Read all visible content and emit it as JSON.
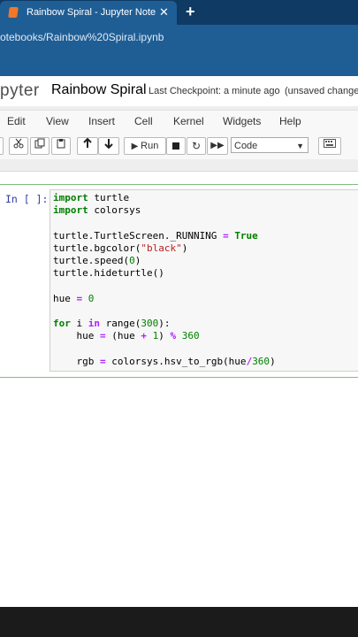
{
  "browser": {
    "tab_title": "Rainbow Spiral - Jupyter Notebook",
    "tab_close": "✕",
    "new_tab": "+",
    "url": "otebooks/Rainbow%20Spiral.ipynb"
  },
  "header": {
    "logo": "pyter",
    "notebook_name": "Rainbow Spiral",
    "checkpoint": "Last Checkpoint: a minute ago",
    "save_status": "(unsaved changes)"
  },
  "menu": [
    "Edit",
    "View",
    "Insert",
    "Cell",
    "Kernel",
    "Widgets",
    "Help"
  ],
  "toolbar": {
    "run_label": "Run",
    "cell_type": "Code",
    "icons": [
      "cut-icon",
      "copy-icon",
      "paste-icon",
      "move-up-icon",
      "move-down-icon",
      "run-icon",
      "stop-icon",
      "restart-icon",
      "fast-forward-icon",
      "keyboard-icon"
    ]
  },
  "cell": {
    "prompt": "In [ ]:",
    "code_lines": [
      "import turtle",
      "import colorsys",
      "",
      "turtle.TurtleScreen._RUNNING = True",
      "turtle.bgcolor(\"black\")",
      "turtle.speed(0)",
      "turtle.hideturtle()",
      "",
      "hue = 0",
      "",
      "for i in range(300):",
      "    hue = (hue + 1) % 360",
      "",
      "    rgb = colorsys.hsv_to_rgb(hue/360)"
    ]
  },
  "colors": {
    "tab_bar": "#0f3a63",
    "address_bar": "#1f5e95",
    "cell_border": "#7fbf7f",
    "prompt": "#303f9f",
    "keyword": "#008000",
    "string": "#ba2121"
  }
}
